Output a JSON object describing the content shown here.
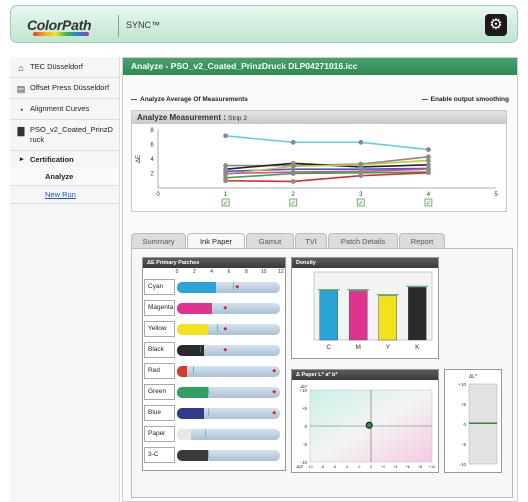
{
  "header": {
    "logo": "ColorPath",
    "product": "SYNC™",
    "settings_icon": "gear-icon"
  },
  "sidebar": {
    "items": [
      {
        "label": "TEC Düsseldorf",
        "icon": "location-icon"
      },
      {
        "label": "Offset Press Düsseldorf",
        "icon": "printer-icon"
      },
      {
        "label": "Alignment Curves",
        "icon": "curves-icon"
      },
      {
        "label": "PSO_v2_Coated_PrinzDruck",
        "icon": "document-icon"
      }
    ],
    "certification": "Certification",
    "analyze": "Analyze",
    "new_run": "New Run"
  },
  "main": {
    "title": "Analyze - PSO_v2_Coated_PrinzDruck DLP04271016.icc",
    "option_left": "Analyze Average Of Measurements",
    "option_right": "Enable output smoothing",
    "measure_title": "Analyze Measurement :",
    "measure_strip": "Strip 2"
  },
  "measure_chart": {
    "type": "line",
    "x_ticks": [
      "0",
      "1",
      "2",
      "3",
      "4",
      "5"
    ],
    "y_ticks": [
      "8",
      "6",
      "4",
      "2"
    ],
    "ylabel": "ΔE",
    "xlim": [
      0,
      5
    ],
    "ylim": [
      0,
      8
    ],
    "series": [
      {
        "color": "#5fd3e0",
        "x": [
          1,
          2,
          3,
          4
        ],
        "values": [
          7.2,
          6.3,
          6.3,
          5.3
        ]
      },
      {
        "color": "#888888",
        "x": [
          1,
          2,
          3,
          4
        ],
        "values": [
          3.1,
          3.1,
          3.3,
          4.3
        ]
      },
      {
        "color": "#222222",
        "x": [
          1,
          2,
          3,
          4
        ],
        "values": [
          2.6,
          3.4,
          2.9,
          3.2
        ]
      },
      {
        "color": "#3c5bd8",
        "x": [
          1,
          2,
          3,
          4
        ],
        "values": [
          2.3,
          2.6,
          2.6,
          2.7
        ]
      },
      {
        "color": "#c9c035",
        "x": [
          1,
          2,
          3,
          4
        ],
        "values": [
          1.9,
          3.0,
          3.2,
          3.8
        ]
      },
      {
        "color": "#e04a9a",
        "x": [
          1,
          2,
          3,
          4
        ],
        "values": [
          2.0,
          2.2,
          2.3,
          2.6
        ]
      },
      {
        "color": "#2fa84f",
        "x": [
          1,
          2,
          3,
          4
        ],
        "values": [
          1.4,
          2.0,
          2.1,
          2.2
        ]
      },
      {
        "color": "#e02a2a",
        "x": [
          1,
          2,
          3,
          4
        ],
        "values": [
          1.0,
          0.9,
          1.7,
          2.1
        ]
      }
    ],
    "checkbox_at": [
      1,
      2,
      3,
      4
    ]
  },
  "tabs": [
    "Summary",
    "Ink Paper",
    "Gamut",
    "TVI",
    "Patch Details",
    "Report"
  ],
  "active_tab": "Ink Paper",
  "ink_panel": {
    "title": "ΔE Primary Patches",
    "scale": [
      "0",
      "2",
      "4",
      "6",
      "8",
      "10",
      "12"
    ],
    "rows": [
      {
        "label": "Cyan",
        "color": "#2aa3d9",
        "value": 4.6,
        "target": 6.5,
        "mark": 6.8
      },
      {
        "label": "Magenta",
        "color": "#e0338f",
        "value": 4.1,
        "target": 3.6,
        "mark": 5.4
      },
      {
        "label": "Yellow",
        "color": "#f2e21e",
        "value": 3.6,
        "target": 4.6,
        "mark": 5.4
      },
      {
        "label": "Black",
        "color": "#2b2b2b",
        "value": 3.1,
        "target": 2.6,
        "mark": 5.4
      },
      {
        "label": "Red",
        "color": "#d63a2a",
        "value": 1.2,
        "target": 1.8,
        "mark": 11.1
      },
      {
        "label": "Green",
        "color": "#2fa060",
        "value": 3.6,
        "target": 3.6,
        "mark": 11.1
      },
      {
        "label": "Blue",
        "color": "#2f3b8f",
        "value": 3.1,
        "target": 3.6,
        "mark": 11.1
      },
      {
        "label": "Paper",
        "color": "#e8e8e8",
        "value": 1.6,
        "target": 3.2,
        "mark": null
      },
      {
        "label": "3-C",
        "color": "#3a3a3a",
        "value": 3.6,
        "target": 3.6,
        "mark": null
      }
    ]
  },
  "density_panel": {
    "title": "Density",
    "type": "bar",
    "categories": [
      "C",
      "M",
      "Y",
      "K"
    ],
    "values": [
      1.45,
      1.45,
      1.3,
      1.55
    ],
    "colors": [
      "#2aa3d9",
      "#e0338f",
      "#f2e21e",
      "#2b2b2b"
    ],
    "ylim": [
      0,
      2
    ]
  },
  "lab_panel": {
    "title": "Δ Paper L* a* b*",
    "y_ticks": [
      "+10",
      "+5",
      "0",
      "-5",
      "-10"
    ],
    "x_ticks": [
      "-10",
      "-8",
      "-6",
      "-4",
      "-2",
      "0",
      "+2",
      "+4",
      "+6",
      "+8",
      "+10"
    ],
    "ylabel": "Δb*",
    "xlabel": "Δa*",
    "point": {
      "a": -0.3,
      "b": 0.2
    }
  },
  "deltaL_panel": {
    "title": "ΔL*",
    "y_ticks": [
      "+10",
      "+5",
      "0",
      "-5",
      "-10"
    ],
    "value": 0.2
  }
}
